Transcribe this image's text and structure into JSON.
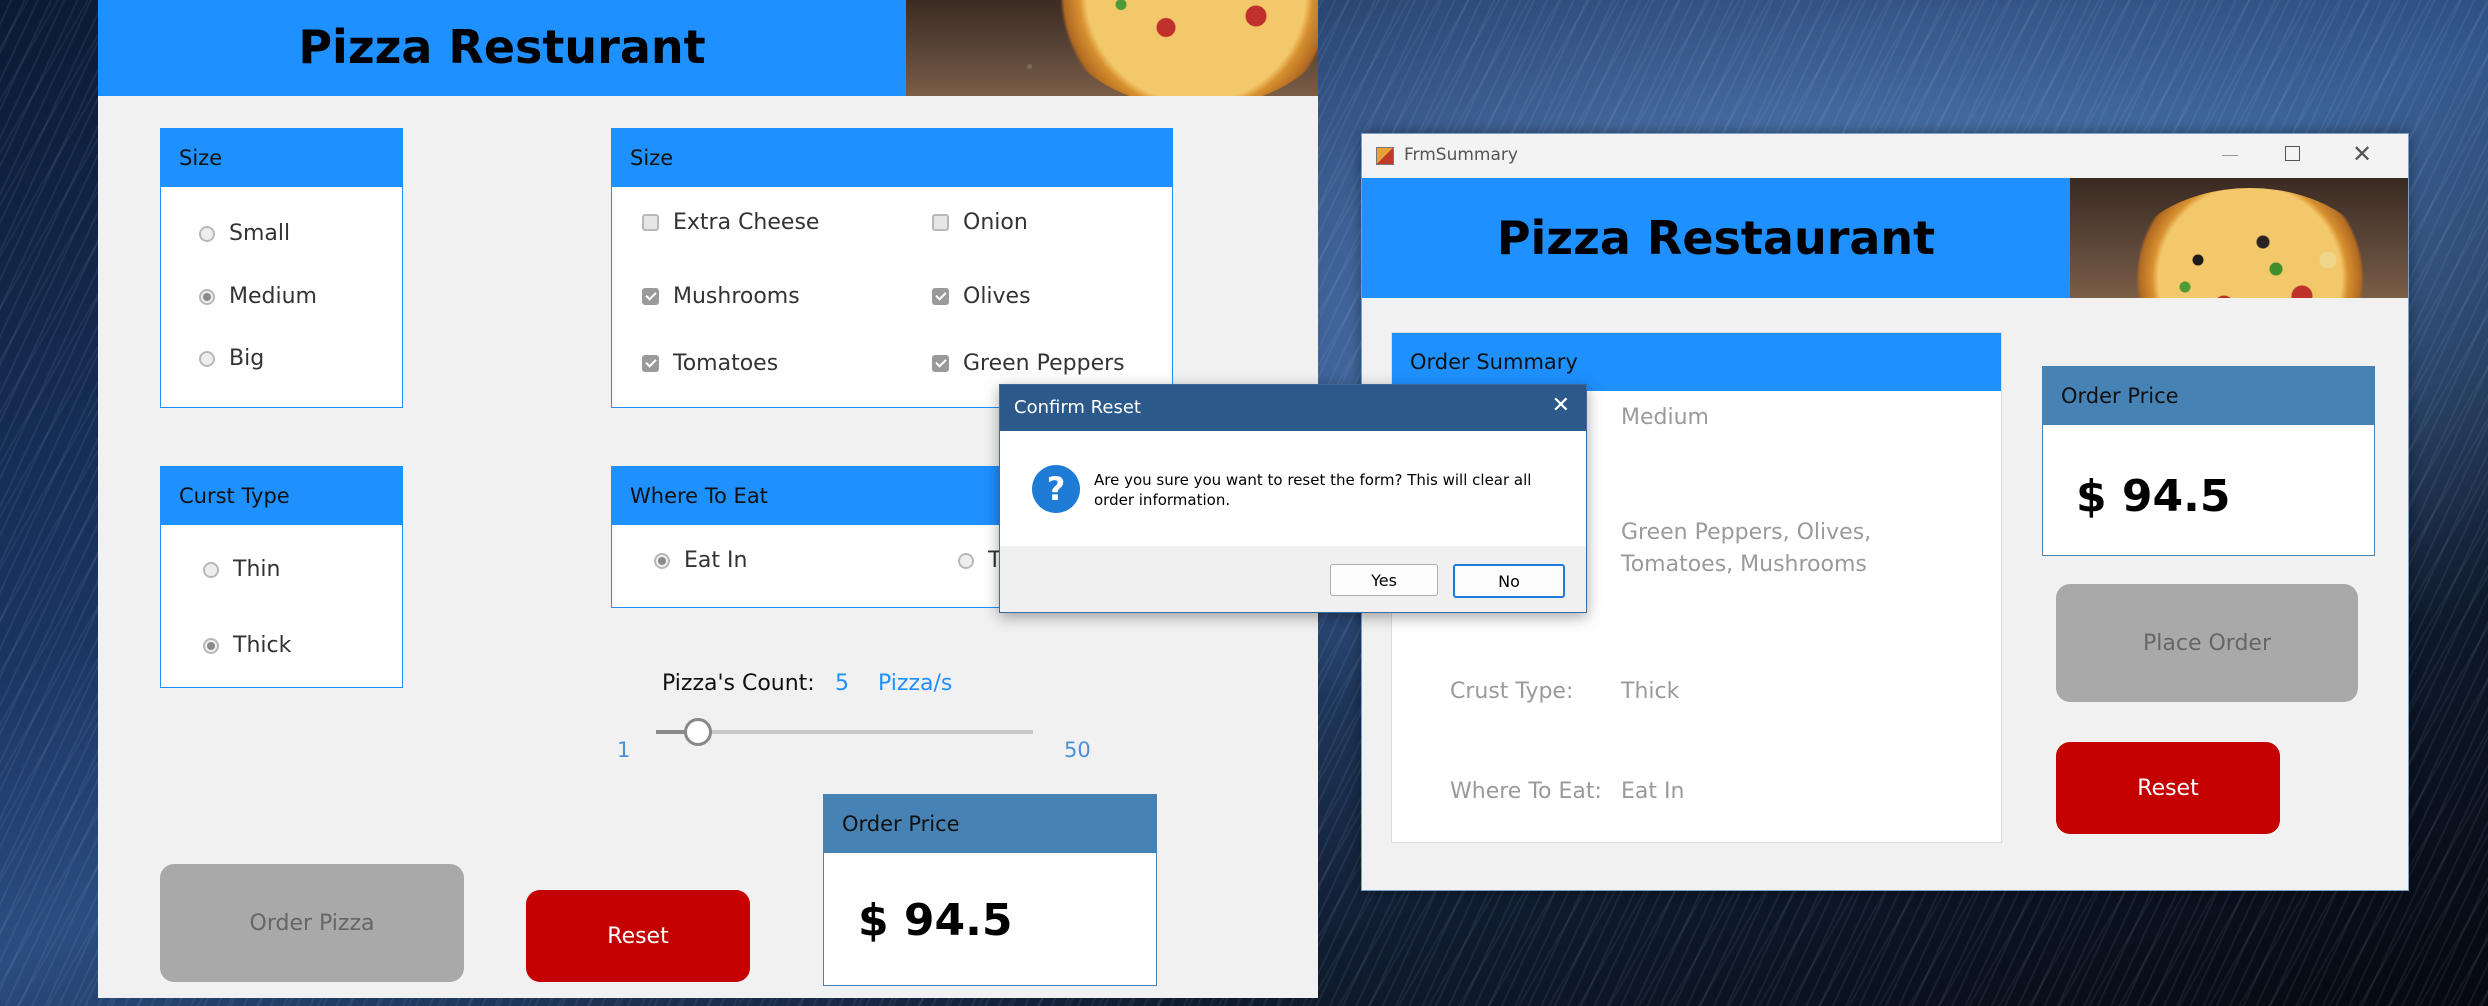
{
  "main_form": {
    "title": "Pizza Resturant",
    "size_group": {
      "title": "Size",
      "options": [
        "Small",
        "Medium",
        "Big"
      ],
      "selected": "Medium"
    },
    "toppings_group": {
      "title": "Size",
      "items": [
        {
          "label": "Extra Cheese",
          "checked": false
        },
        {
          "label": "Onion",
          "checked": false
        },
        {
          "label": "Mushrooms",
          "checked": true
        },
        {
          "label": "Olives",
          "checked": true
        },
        {
          "label": "Tomatoes",
          "checked": true
        },
        {
          "label": "Green Peppers",
          "checked": true
        }
      ]
    },
    "crust_group": {
      "title": "Curst Type",
      "options": [
        "Thin",
        "Thick"
      ],
      "selected": "Thick"
    },
    "where_group": {
      "title": "Where To Eat",
      "options": [
        "Eat In",
        "T"
      ],
      "selected": "Eat In"
    },
    "count": {
      "label": "Pizza's Count:",
      "value": "5",
      "unit": "Pizza/s",
      "min": "1",
      "max": "50",
      "level": 5
    },
    "price_box": {
      "title": "Order Price",
      "value": "$ 94.5"
    },
    "order_button": "Order Pizza",
    "reset_button": "Reset"
  },
  "summary_window": {
    "window_title": "FrmSummary",
    "title": "Pizza Restaurant",
    "summary_box": {
      "title": "Order Summary",
      "size_value": "Medium",
      "toppings_value_line1": "Green Peppers, Olives,",
      "toppings_value_line2": "Tomatoes, Mushrooms",
      "crust_label": "Crust Type:",
      "crust_value": "Thick",
      "where_label": "Where To Eat:",
      "where_value": "Eat In"
    },
    "price_box": {
      "title": "Order Price",
      "value": "$ 94.5"
    },
    "place_order_button": "Place Order",
    "reset_button": "Reset"
  },
  "dialog": {
    "title": "Confirm Reset",
    "close_glyph": "✕",
    "icon_glyph": "?",
    "message_line1": "Are you sure you want to reset the form? This will clear all",
    "message_line2": "order information.",
    "yes": "Yes",
    "no": "No"
  },
  "colors": {
    "accent": "#1e90ff",
    "steel": "#4682b4",
    "danger": "#c40000",
    "disabled": "#a9a9a9"
  }
}
